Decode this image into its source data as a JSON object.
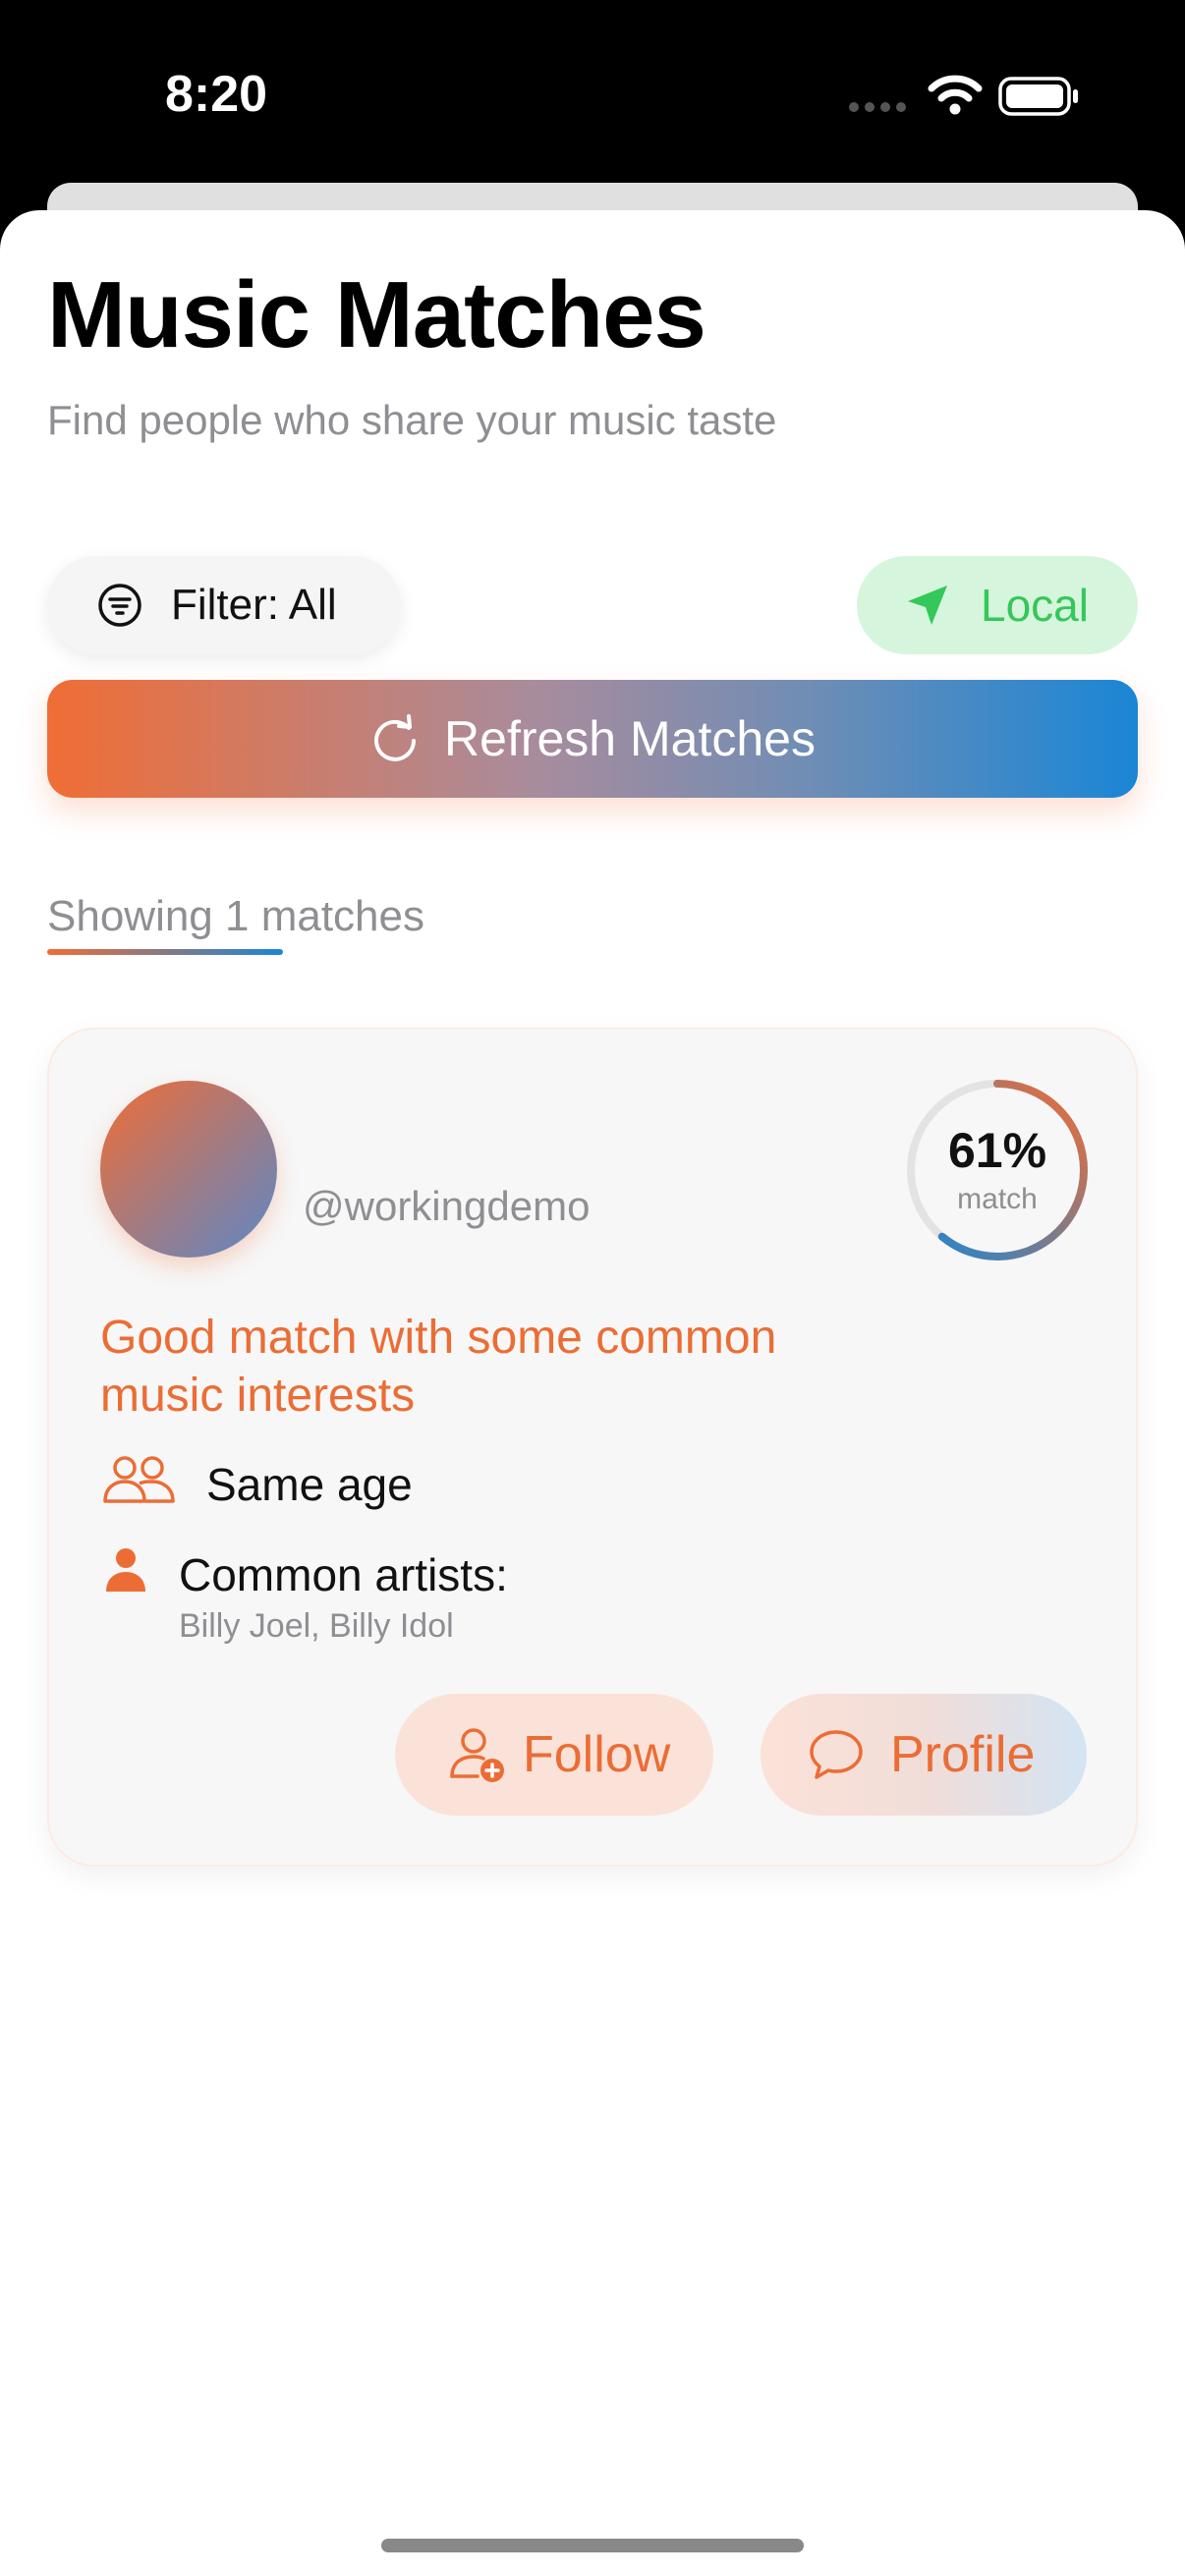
{
  "status_bar": {
    "time": "8:20"
  },
  "header": {
    "title": "Music Matches",
    "subtitle": "Find people who share your music taste"
  },
  "controls": {
    "filter_label": "Filter: All",
    "location_label": "Local",
    "refresh_label": "Refresh Matches"
  },
  "results": {
    "count_text": "Showing 1 matches"
  },
  "match_card": {
    "username": "@workingdemo",
    "match_percent_text": "61%",
    "match_fraction": 0.61,
    "match_label": "match",
    "description": "Good match with some common music interests",
    "same_age_label": "Same age",
    "artists_heading": "Common artists:",
    "artists_list": "Billy Joel, Billy Idol",
    "follow_label": "Follow",
    "profile_label": "Profile"
  },
  "colors": {
    "accent_orange": "#eb6d35",
    "accent_blue": "#1a86d6",
    "local_green": "#34c759",
    "muted_text": "#8e8e93"
  },
  "icons": {
    "filter": "filter-icon",
    "location": "location-arrow-icon",
    "refresh": "refresh-icon",
    "same_age": "people-icon",
    "artist": "person-icon",
    "follow": "person-add-icon",
    "profile": "speech-bubble-icon"
  }
}
